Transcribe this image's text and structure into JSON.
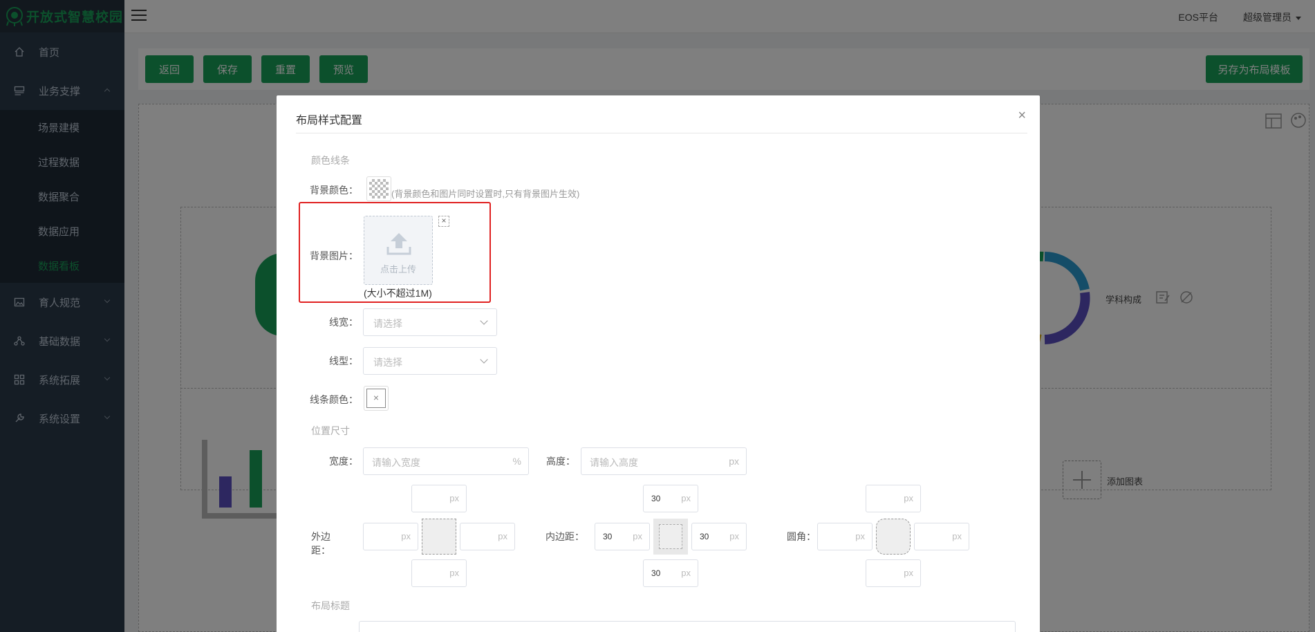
{
  "app": {
    "logo_text": "开放式智慧校园"
  },
  "sidebar": {
    "items": [
      {
        "label": "首页",
        "icon": "home-icon"
      },
      {
        "label": "业务支撑",
        "icon": "dashboard-icon"
      },
      {
        "label": "育人规范",
        "icon": "picture-icon"
      },
      {
        "label": "基础数据",
        "icon": "network-icon"
      },
      {
        "label": "系统拓展",
        "icon": "grid-icon"
      },
      {
        "label": "系统设置",
        "icon": "wrench-icon"
      }
    ],
    "sub_items": [
      {
        "label": "场景建模"
      },
      {
        "label": "过程数据"
      },
      {
        "label": "数据聚合"
      },
      {
        "label": "数据应用"
      },
      {
        "label": "数据看板",
        "active": true
      }
    ]
  },
  "topbar": {
    "platform": "EOS平台",
    "user": "超级管理员"
  },
  "toolbar": {
    "back": "返回",
    "save": "保存",
    "reset": "重置",
    "preview": "预览",
    "save_template": "另存为布局模板"
  },
  "canvas": {
    "chart_label": "学科构成",
    "add_chart": "添加图表"
  },
  "modal": {
    "title": "布局样式配置",
    "section_color": "颜色线条",
    "bg_color_label": "背景颜色：",
    "bg_color_hint": "(背景颜色和图片同时设置时,只有背景图片生效)",
    "bg_image_label": "背景图片：",
    "upload_text": "点击上传",
    "size_hint": "(大小不超过1M)",
    "line_width_label": "线宽：",
    "line_type_label": "线型：",
    "select_placeholder": "请选择",
    "line_color_label": "线条颜色：",
    "section_position": "位置尺寸",
    "width_label": "宽度：",
    "width_placeholder": "请输入宽度",
    "width_unit": "%",
    "height_label": "高度：",
    "height_placeholder": "请输入高度",
    "height_unit": "px",
    "margin_label": "外边距：",
    "padding_label": "内边距：",
    "radius_label": "圆角：",
    "unit_px": "px",
    "padding_values": {
      "top": "30",
      "left": "30",
      "right": "30",
      "bottom": "30"
    },
    "section_title": "布局标题"
  },
  "colors": {
    "accent": "#18a058",
    "sidebar": "#2b3a4a",
    "highlight": "#e02020"
  }
}
